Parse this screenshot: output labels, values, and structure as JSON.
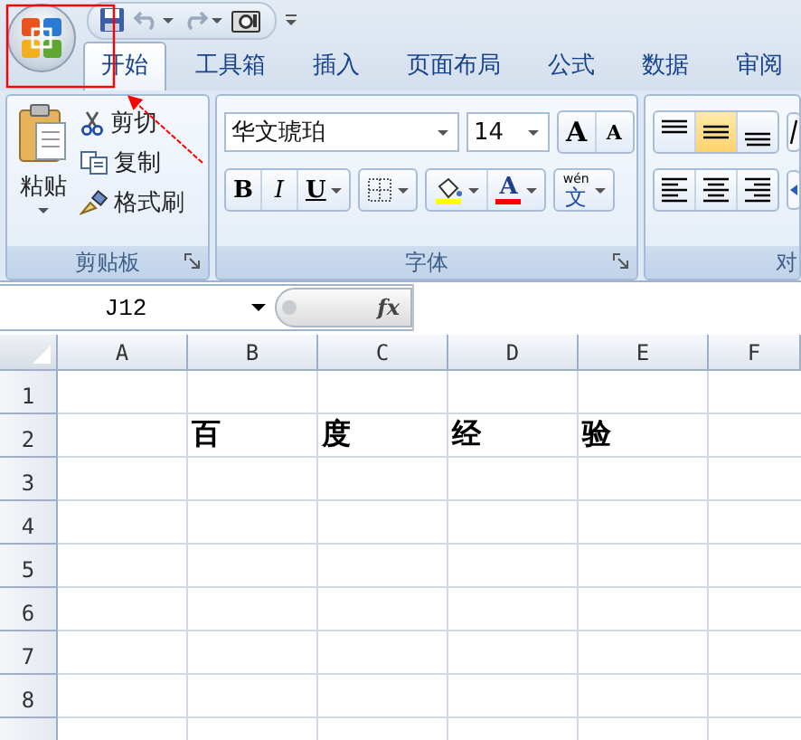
{
  "tabs": [
    {
      "label": "开始",
      "selected": true
    },
    {
      "label": "工具箱",
      "selected": false
    },
    {
      "label": "插入",
      "selected": false
    },
    {
      "label": "页面布局",
      "selected": false
    },
    {
      "label": "公式",
      "selected": false
    },
    {
      "label": "数据",
      "selected": false
    },
    {
      "label": "审阅",
      "selected": false
    }
  ],
  "clipboard": {
    "title": "剪贴板",
    "paste": "粘贴",
    "actions": [
      {
        "kind": "cut",
        "label": "剪切"
      },
      {
        "kind": "copy",
        "label": "复制"
      },
      {
        "kind": "brush",
        "label": "格式刷"
      }
    ]
  },
  "font": {
    "title": "字体",
    "name": "华文琥珀",
    "size": "14",
    "grow": "A",
    "shrink": "A",
    "styles": [
      {
        "kind": "bold",
        "label": "B"
      },
      {
        "kind": "italic",
        "label": "I"
      },
      {
        "kind": "underline",
        "label": "U"
      }
    ],
    "font_color_label": "A",
    "phonetic_top": "wén",
    "phonetic_bottom": "文"
  },
  "alignment": {
    "title": "对",
    "buttons": [
      {
        "kind": "top",
        "selected": false
      },
      {
        "kind": "middle",
        "selected": true
      },
      {
        "kind": "bottom",
        "selected": false
      },
      {
        "kind": "left",
        "selected": false
      },
      {
        "kind": "center",
        "selected": false
      },
      {
        "kind": "right",
        "selected": false
      }
    ]
  },
  "formula_bar": {
    "name_box": "J12",
    "fx": "fx"
  },
  "sheet": {
    "columns": [
      "A",
      "B",
      "C",
      "D",
      "E",
      "F"
    ],
    "rows": [
      {
        "header": "1",
        "cells": [
          null,
          null,
          null,
          null,
          null,
          null
        ]
      },
      {
        "header": "2",
        "cells": [
          null,
          "百",
          "度",
          "经",
          "验",
          null
        ]
      },
      {
        "header": "3"
      },
      {
        "header": "4"
      },
      {
        "header": "5"
      },
      {
        "header": "6"
      },
      {
        "header": "7"
      },
      {
        "header": "8"
      }
    ]
  }
}
